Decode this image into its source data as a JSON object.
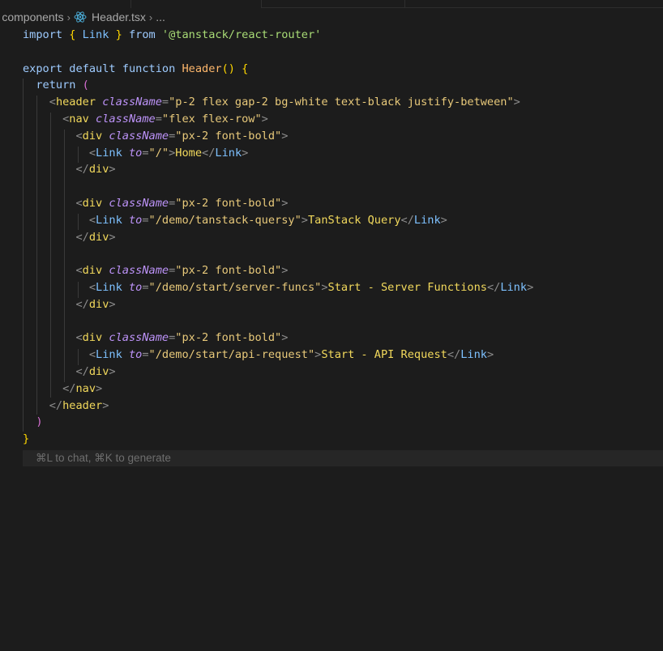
{
  "breadcrumb": {
    "folder": "components",
    "file": "Header.tsx",
    "ellipsis": "..."
  },
  "code": {
    "l1": {
      "k1": "import",
      "b1": "{",
      "id": "Link",
      "b2": "}",
      "k2": "from",
      "s": "'@tanstack/react-router'"
    },
    "l3": {
      "k1": "export",
      "k2": "default",
      "k3": "function",
      "fn": "Header",
      "p": "()",
      "b": "{"
    },
    "l4": {
      "k": "return",
      "p": "("
    },
    "l5": {
      "tag": "header",
      "attr": "className",
      "val": "\"p-2 flex gap-2 bg-white text-black justify-between\""
    },
    "l6": {
      "tag": "nav",
      "attr": "className",
      "val": "\"flex flex-row\""
    },
    "l7": {
      "tag": "div",
      "attr": "className",
      "val": "\"px-2 font-bold\""
    },
    "l8": {
      "tag": "Link",
      "attr": "to",
      "val": "\"/\"",
      "text": "Home",
      "close": "Link"
    },
    "l9": {
      "close": "div"
    },
    "l11": {
      "tag": "div",
      "attr": "className",
      "val": "\"px-2 font-bold\""
    },
    "l12": {
      "tag": "Link",
      "attr": "to",
      "val": "\"/demo/tanstack-quersy\"",
      "text": "TanStack Query",
      "close": "Link"
    },
    "l13": {
      "close": "div"
    },
    "l15": {
      "tag": "div",
      "attr": "className",
      "val": "\"px-2 font-bold\""
    },
    "l16": {
      "tag": "Link",
      "attr": "to",
      "val": "\"/demo/start/server-funcs\"",
      "text": "Start - Server Functions",
      "close": "Link"
    },
    "l17": {
      "close": "div"
    },
    "l19": {
      "tag": "div",
      "attr": "className",
      "val": "\"px-2 font-bold\""
    },
    "l20": {
      "tag": "Link",
      "attr": "to",
      "val": "\"/demo/start/api-request\"",
      "text": "Start - API Request",
      "close": "Link"
    },
    "l21": {
      "close": "div"
    },
    "l22": {
      "close": "nav"
    },
    "l23": {
      "close": "header"
    },
    "l24": {
      "p": ")"
    },
    "l25": {
      "b": "}"
    }
  },
  "hint": "⌘L to chat, ⌘K to generate",
  "icons": {
    "breadcrumb_separator": "chevron-right-icon",
    "file_type": "react-icon"
  },
  "colors": {
    "background": "#1c1c1c",
    "react_icon": "#4fb8e6"
  }
}
